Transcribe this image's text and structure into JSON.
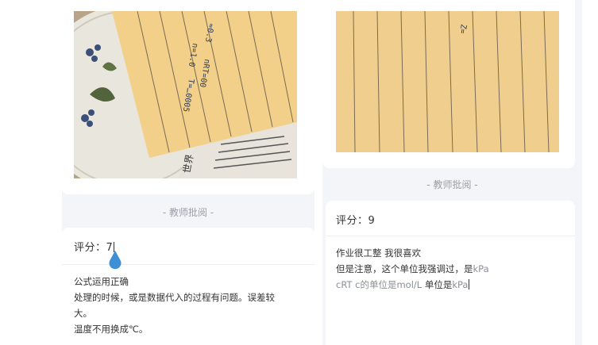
{
  "left": {
    "section_label": "- 教师批阅 -",
    "score_prefix": "评分：",
    "score_value": "7",
    "comment_lines": [
      "公式运用正确",
      "处理的时候，或是数据代入的过程有问题。误差较",
      "大。",
      "温度不用换成℃。"
    ]
  },
  "right": {
    "section_label": "- 教师批阅 -",
    "score_prefix": "评分：",
    "score_value": "9",
    "comment_line1": "作业很工整 我很喜欢",
    "comment_line2_a": "但是注意，这个单位我强调过，是",
    "comment_line2_b": "kPa",
    "comment_line3_a": "cRT c的单位是",
    "comment_line3_b": "mol/L",
    "comment_line3_c": " 单位是",
    "comment_line3_d": "kPa"
  },
  "colors": {
    "page_bg": "#f3f5f8",
    "card_bg": "#ffffff",
    "accent_drop": "#3d8fd6",
    "muted": "#9a9ea6"
  }
}
